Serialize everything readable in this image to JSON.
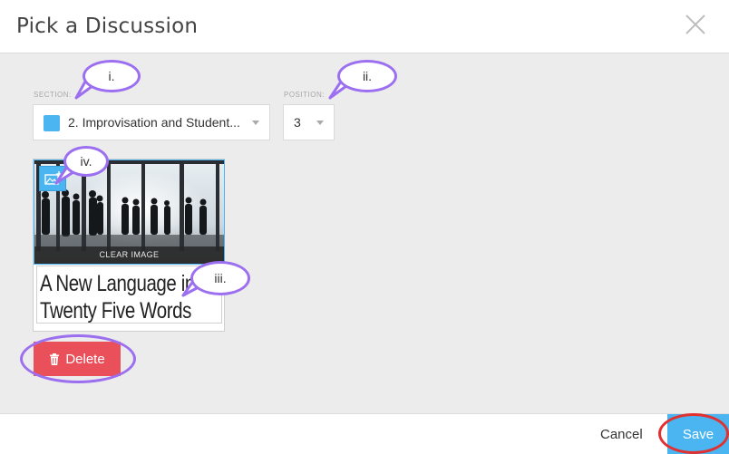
{
  "dialog": {
    "title": "Pick a Discussion"
  },
  "section": {
    "label": "SECTION:",
    "value": "2. Improvisation and Student...",
    "swatch_color": "#4ab5f0"
  },
  "position": {
    "label": "POSITION:",
    "value": "3"
  },
  "card": {
    "clear_image_label": "CLEAR IMAGE",
    "title_line1": "A New Language in",
    "title_line2": "Twenty Five Words"
  },
  "actions": {
    "delete_label": "Delete",
    "cancel_label": "Cancel",
    "save_label": "Save"
  },
  "annotations": {
    "i": "i.",
    "ii": "ii.",
    "iii": "iii.",
    "iv": "iv."
  },
  "colors": {
    "accent": "#4ab5f0",
    "danger": "#e9505a",
    "annotation": "#9b6ff0",
    "highlight_red": "#e23030"
  }
}
